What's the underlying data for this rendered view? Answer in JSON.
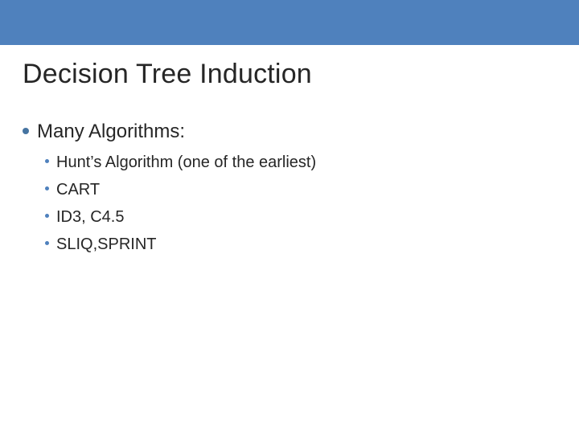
{
  "colors": {
    "accent_bar": "#4f81bd",
    "bullet_primary": "#4674a1",
    "bullet_secondary": "#4f81bd",
    "text": "#262626"
  },
  "title": "Decision Tree Induction",
  "bullets": [
    {
      "text": "Many Algorithms:",
      "sub": [
        "Hunt’s Algorithm (one of the earliest)",
        "CART",
        "ID3, C4.5",
        "SLIQ,SPRINT"
      ]
    }
  ]
}
